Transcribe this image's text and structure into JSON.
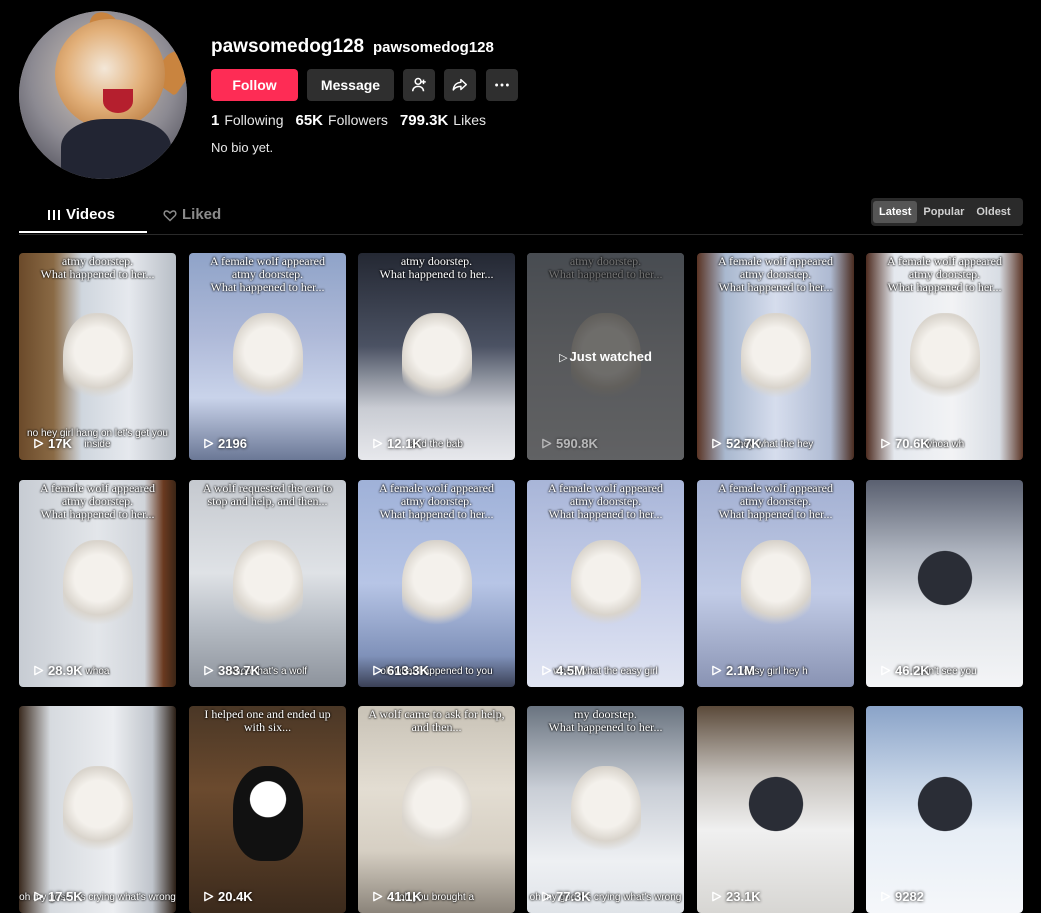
{
  "profile": {
    "username": "pawsomedog128",
    "nickname": "pawsomedog128",
    "follow_label": "Follow",
    "message_label": "Message",
    "following_count": "1",
    "following_label": "Following",
    "followers_count": "65K",
    "followers_label": "Followers",
    "likes_count": "799.3K",
    "likes_label": "Likes",
    "bio": "No bio yet."
  },
  "tabs": {
    "videos": "Videos",
    "liked": "Liked"
  },
  "sort": {
    "latest": "Latest",
    "popular": "Popular",
    "oldest": "Oldest",
    "selected": "Latest"
  },
  "colors": {
    "accent": "#fe2c55",
    "button_dark": "#2f2f2f"
  },
  "videos": [
    {
      "caption": "atmy doorstep.\nWhat happened to her...",
      "subtitle": "no hey girl hang on let's get you inside",
      "views": "17K"
    },
    {
      "caption": "A female wolf appeared atmy doorstep.\nWhat happened to her...",
      "subtitle": "",
      "views": "2196"
    },
    {
      "caption": "atmy doorstep.\nWhat happened to her...",
      "subtitle": "and the bab",
      "views": "12.1K"
    },
    {
      "caption": "atmy doorstep.\nWhat happened to her...",
      "subtitle": "",
      "views": "590.8K",
      "watched": "Just watched"
    },
    {
      "caption": "A female wolf appeared atmy doorstep.\nWhat happened to her...",
      "subtitle": "hey what the hey",
      "views": "52.7K"
    },
    {
      "caption": "A female wolf appeared atmy doorstep.\nWhat happened to her...",
      "subtitle": "whoa wh",
      "views": "70.6K"
    },
    {
      "caption": "A female wolf appeared atmy doorstep.\nWhat happened to her...",
      "subtitle": "whoa",
      "views": "28.9K"
    },
    {
      "caption": "A wolf requested the car to stop and help, and then...",
      "subtitle": "whoa that's a wolf",
      "views": "383.7K"
    },
    {
      "caption": "A female wolf appeared atmy doorstep.\nWhat happened to her...",
      "subtitle": "oh what happened to you",
      "views": "613.3K"
    },
    {
      "caption": "A female wolf appeared atmy doorstep.\nWhat happened to her...",
      "subtitle": "whoa what the easy girl",
      "views": "4.5M"
    },
    {
      "caption": "A female wolf appeared atmy doorstep.\nWhat happened to her...",
      "subtitle": "easy girl hey h",
      "views": "2.1M"
    },
    {
      "caption": "",
      "subtitle": "I can't see you",
      "views": "46.2K"
    },
    {
      "caption": "",
      "subtitle": "oh my gosh it's crying what's wrong",
      "views": "17.5K"
    },
    {
      "caption": "I helped one and ended up with six...",
      "subtitle": "",
      "views": "20.4K"
    },
    {
      "caption": "A wolf came to ask for help, and then...",
      "subtitle": "oh you brought a",
      "views": "41.1K"
    },
    {
      "caption": "my doorstep.\nWhat happened to her...",
      "subtitle": "oh my god it's crying what's wrong",
      "views": "77.3K"
    },
    {
      "caption": "",
      "subtitle": "",
      "views": "23.1K"
    },
    {
      "caption": "",
      "subtitle": "",
      "views": "9282"
    }
  ]
}
